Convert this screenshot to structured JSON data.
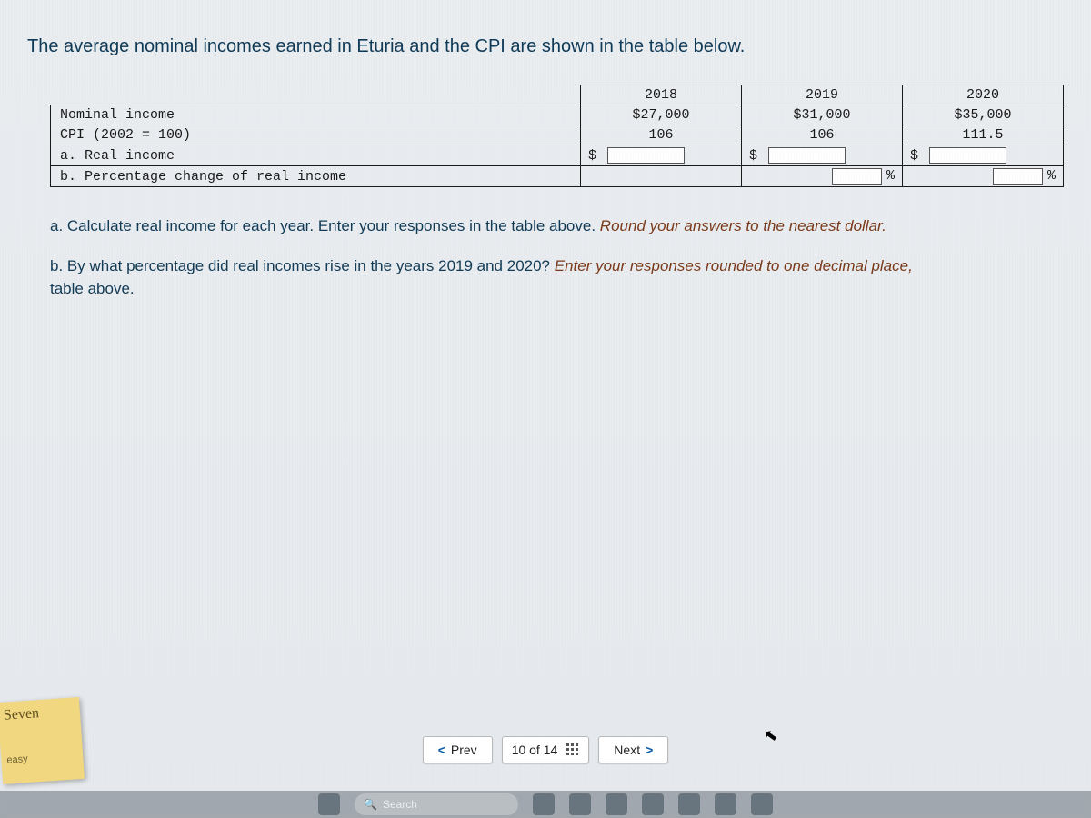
{
  "intro": "The average nominal incomes earned in Eturia and the CPI are shown in the table below.",
  "years": {
    "y1": "2018",
    "y2": "2019",
    "y3": "2020"
  },
  "rows": {
    "nominal_label": "Nominal income",
    "nominal": {
      "y1": "$27,000",
      "y2": "$31,000",
      "y3": "$35,000"
    },
    "cpi_label": "CPI (2002 = 100)",
    "cpi": {
      "y1": "106",
      "y2": "106",
      "y3": "111.5"
    },
    "real_label": "a. Real income",
    "pct_label": "b. Percentage change of real income"
  },
  "symbols": {
    "dollar": "$",
    "percent": "%"
  },
  "questions": {
    "a_prefix": "a. Calculate real income for each year. Enter your responses in the table above. ",
    "a_hint": "Round your answers to the nearest dollar.",
    "b_prefix": "b. By what percentage did real incomes rise in the years 2019 and 2020? ",
    "b_hint": "Enter your responses rounded to one decimal place,",
    "b_suffix2": "table above."
  },
  "pager": {
    "prev": "Prev",
    "pos": "10 of 14",
    "next": "Next"
  },
  "taskbar": {
    "search_placeholder": "Search"
  },
  "sticky": {
    "line1": "Seven",
    "line2": "easy"
  }
}
